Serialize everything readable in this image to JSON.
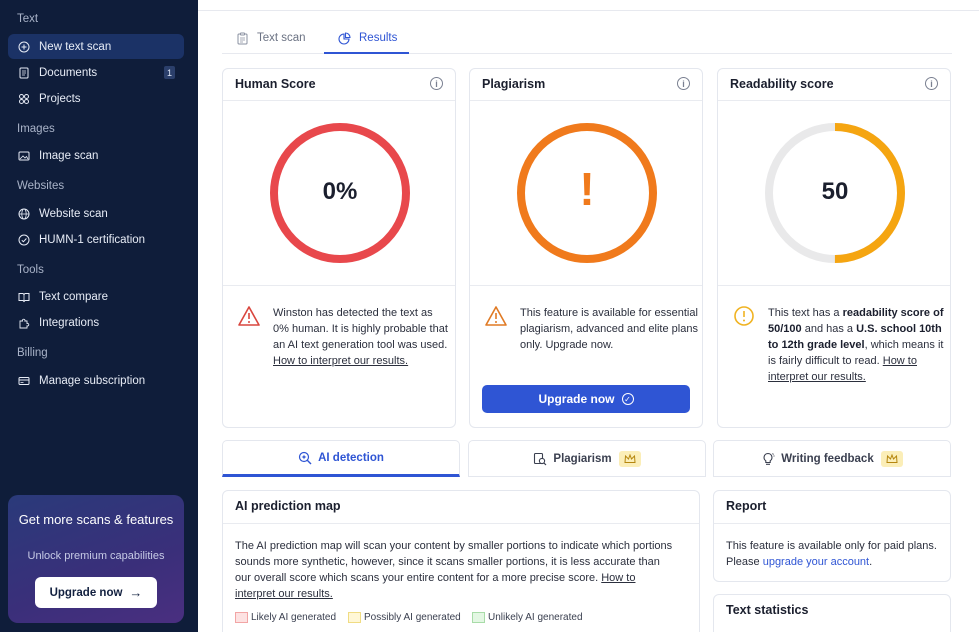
{
  "sidebar": {
    "sections": {
      "text": "Text",
      "images": "Images",
      "websites": "Websites",
      "tools": "Tools",
      "billing": "Billing"
    },
    "items": {
      "new_text_scan": "New text scan",
      "documents": "Documents",
      "documents_count": "1",
      "projects": "Projects",
      "image_scan": "Image scan",
      "website_scan": "Website scan",
      "humn_cert": "HUMN-1 certification",
      "text_compare": "Text compare",
      "integrations": "Integrations",
      "manage_subscription": "Manage subscription"
    },
    "promo": {
      "title": "Get more scans & features",
      "subtitle": "Unlock premium capabilities",
      "button": "Upgrade now"
    }
  },
  "tabs": {
    "text_scan": "Text scan",
    "results": "Results"
  },
  "cards": {
    "human": {
      "title": "Human Score",
      "value": "0%",
      "note_a": "Winston has detected the text as 0% human. It is highly probable that an AI text generation tool was used.",
      "note_link": "How to interpret our results."
    },
    "plagiarism": {
      "title": "Plagiarism",
      "symbol": "!",
      "note": "This feature is available for essential plagiarism, advanced and elite plans only. Upgrade now.",
      "button": "Upgrade now"
    },
    "readability": {
      "title": "Readability score",
      "value": "50",
      "progress": 0.5,
      "note_a": "This text has a",
      "note_b": "readability score of 50/100",
      "note_c": "and has a",
      "note_d": "U.S. school 10th to 12th grade level",
      "note_e": ", which means it is fairly difficult to read.",
      "note_link": "How to interpret our results."
    }
  },
  "subtabs": {
    "ai_detection": "AI detection",
    "plagiarism": "Plagiarism",
    "writing_feedback": "Writing feedback"
  },
  "prediction": {
    "title": "AI prediction map",
    "text": "The AI prediction map will scan your content by smaller portions to indicate which portions sounds more synthetic, however, since it scans smaller portions, it is less accurate than our overall score which scans your entire content for a more precise score.",
    "link": "How to interpret our results.",
    "legend": {
      "likely": "Likely AI generated",
      "possibly": "Possibly AI generated",
      "unlikely": "Unlikely AI generated"
    }
  },
  "report": {
    "title": "Report",
    "text": "This feature is available only for paid plans. Please",
    "link": "upgrade your account",
    "end": "."
  },
  "text_statistics": {
    "title": "Text statistics"
  },
  "colors": {
    "sidebar_bg": "#0f1d3a",
    "accent": "#2f55d4",
    "human_ring": "#e8484c",
    "plagiarism_ring": "#f07a1c",
    "readability_ring": "#f5a511"
  }
}
